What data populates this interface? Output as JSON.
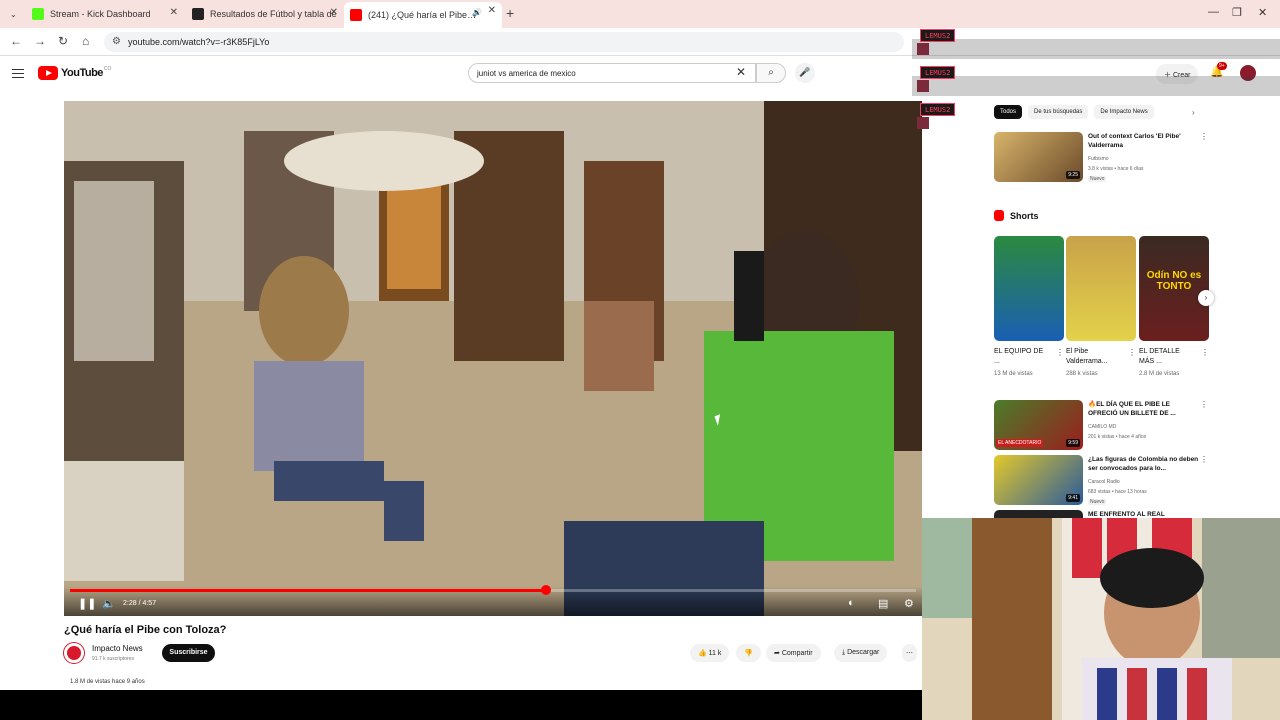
{
  "browser": {
    "tabs": [
      {
        "label": "Stream - Kick Dashboard",
        "favicon_color": "#53fc18"
      },
      {
        "label": "Resultados de Fútbol y tabla de",
        "favicon_color": "#222222"
      },
      {
        "label": "(241) ¿Qué haría el Pibe co",
        "favicon_color": "#ff0000"
      }
    ],
    "new_tab": "+",
    "url": "youtube.com/watch?v=-r3K85FjLYo"
  },
  "youtube": {
    "logo_text": "YouTube",
    "logo_country": "CO",
    "search_value": "juniot vs america de mexico",
    "create_label": "Crear",
    "notifications_badge": "9+"
  },
  "player": {
    "time": "2:28 / 4:57",
    "progress_fraction": 0.5622
  },
  "video": {
    "title": "¿Qué haría el Pibe con Toloza?",
    "channel": "Impacto News",
    "subscribers": "91.7 k suscriptores",
    "subscribe_label": "Suscribirse",
    "likes": "11 k",
    "share_label": "Compartir",
    "download_label": "Descargar",
    "views_line": "1.8 M de vistas  hace 9 años"
  },
  "sidebar": {
    "chips": [
      "Todos",
      "De tus búsquedas",
      "De Impacto News"
    ],
    "top_video": {
      "title": "Out of context Carlos 'El Pibe' Valderrama",
      "channel": "Futbismo",
      "meta": "3.8 k vistas • hace 6 días",
      "badge": "Nuevo",
      "duration": "9:25"
    },
    "shorts_heading": "Shorts",
    "shorts": [
      {
        "label": "EL EQUIPO DE ...",
        "views": "13 M de vistas",
        "overlay": ""
      },
      {
        "label": "El Pibe Valderrama...",
        "views": "288 k vistas",
        "overlay": ""
      },
      {
        "label": "EL DETALLE MÁS ...",
        "views": "2.8 M de vistas",
        "overlay": "Odín NO es TONTO"
      }
    ],
    "videos": [
      {
        "title": "🔥EL DÍA QUE EL PIBE LE OFRECIÓ UN BILLETE DE ...",
        "channel": "CAMILO MD",
        "meta": "201 k vistas • hace 4 años",
        "badge": "",
        "duration": "9:59",
        "thumb_text": "EL ANECDOTARIO"
      },
      {
        "title": "¿Las figuras de Colombia no deben ser convocados para lo...",
        "channel": "Caracol Radio",
        "meta": "683 vistas • hace 13 horas",
        "badge": "Nuevo",
        "duration": "9:41",
        "thumb_text": ""
      }
    ],
    "partial_title": "ME ENFRENTO AL REAL"
  },
  "overlays": {
    "streamer_tag": "LEMUS2"
  }
}
